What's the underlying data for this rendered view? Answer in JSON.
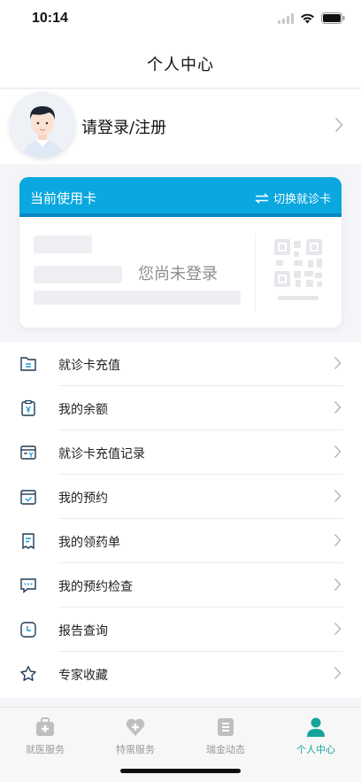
{
  "status_bar": {
    "time": "10:14"
  },
  "nav": {
    "title": "个人中心"
  },
  "profile": {
    "login_label": "请登录/注册"
  },
  "card": {
    "title": "当前使用卡",
    "switch_label": "切换就诊卡",
    "status_text": "您尚未登录"
  },
  "menu": {
    "items": [
      {
        "label": "就诊卡充值",
        "icon": "card-file-icon"
      },
      {
        "label": "我的余额",
        "icon": "wallet-yen-icon"
      },
      {
        "label": "就诊卡充值记录",
        "icon": "card-record-icon"
      },
      {
        "label": "我的预约",
        "icon": "calendar-check-icon"
      },
      {
        "label": "我的领药单",
        "icon": "receipt-icon"
      },
      {
        "label": "我的预约检查",
        "icon": "chat-dots-icon"
      },
      {
        "label": "报告查询",
        "icon": "clock-icon"
      },
      {
        "label": "专家收藏",
        "icon": "star-icon"
      }
    ]
  },
  "tabs": [
    {
      "label": "就医服务",
      "icon": "medical-case-icon",
      "active": false
    },
    {
      "label": "特需服务",
      "icon": "heart-plus-icon",
      "active": false
    },
    {
      "label": "瑞金动态",
      "icon": "news-icon",
      "active": false
    },
    {
      "label": "个人中心",
      "icon": "person-icon",
      "active": true
    }
  ],
  "colors": {
    "card_header": "#0aa7e0",
    "active_tab": "#15a39a",
    "menu_icon": "#1f3a56"
  }
}
